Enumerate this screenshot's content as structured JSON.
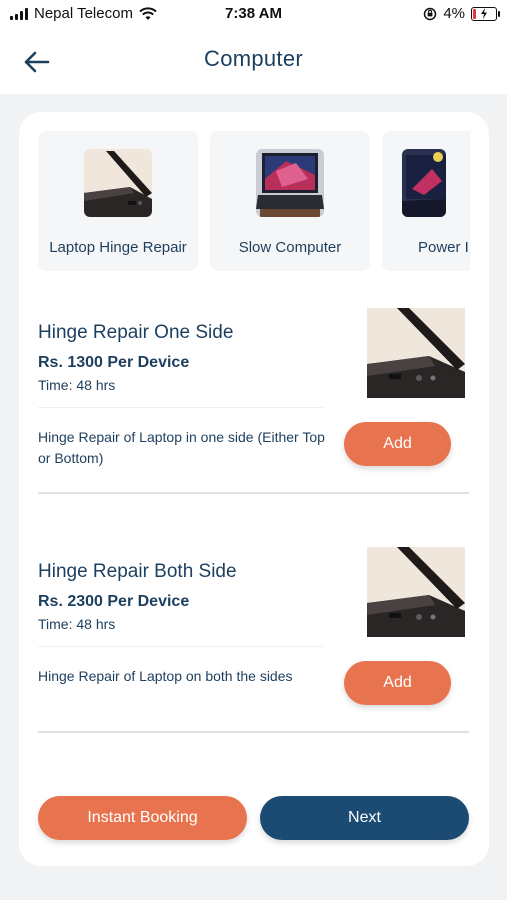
{
  "status_bar": {
    "carrier": "Nepal Telecom",
    "time": "7:38 AM",
    "battery": "4%",
    "icons": [
      "signal-icon",
      "wifi-icon",
      "orientation-lock-icon",
      "battery-icon"
    ]
  },
  "header": {
    "title": "Computer",
    "back_icon": "arrow-left-icon"
  },
  "categories": [
    {
      "label": "Laptop Hinge Repair",
      "image": "laptop-hinge-photo"
    },
    {
      "label": "Slow Computer",
      "image": "laptop-screen-photo"
    },
    {
      "label": "Power I",
      "image": "gaming-laptop-photo"
    }
  ],
  "services": [
    {
      "title": "Hinge Repair One Side",
      "price": "Rs. 1300 Per Device",
      "time": "Time: 48 hrs",
      "description": "Hinge Repair of Laptop in one side (Either Top or Bottom)",
      "add_label": "Add"
    },
    {
      "title": "Hinge Repair Both Side",
      "price": "Rs. 2300 Per Device",
      "time": "Time: 48 hrs",
      "description": "Hinge Repair of Laptop on both the sides",
      "add_label": "Add"
    }
  ],
  "actions": {
    "instant_booking": "Instant Booking",
    "next": "Next"
  },
  "colors": {
    "primary_navy": "#1b4a73",
    "accent_orange": "#e8734f",
    "text": "#1d3f5e",
    "background": "#f1f2f4"
  }
}
